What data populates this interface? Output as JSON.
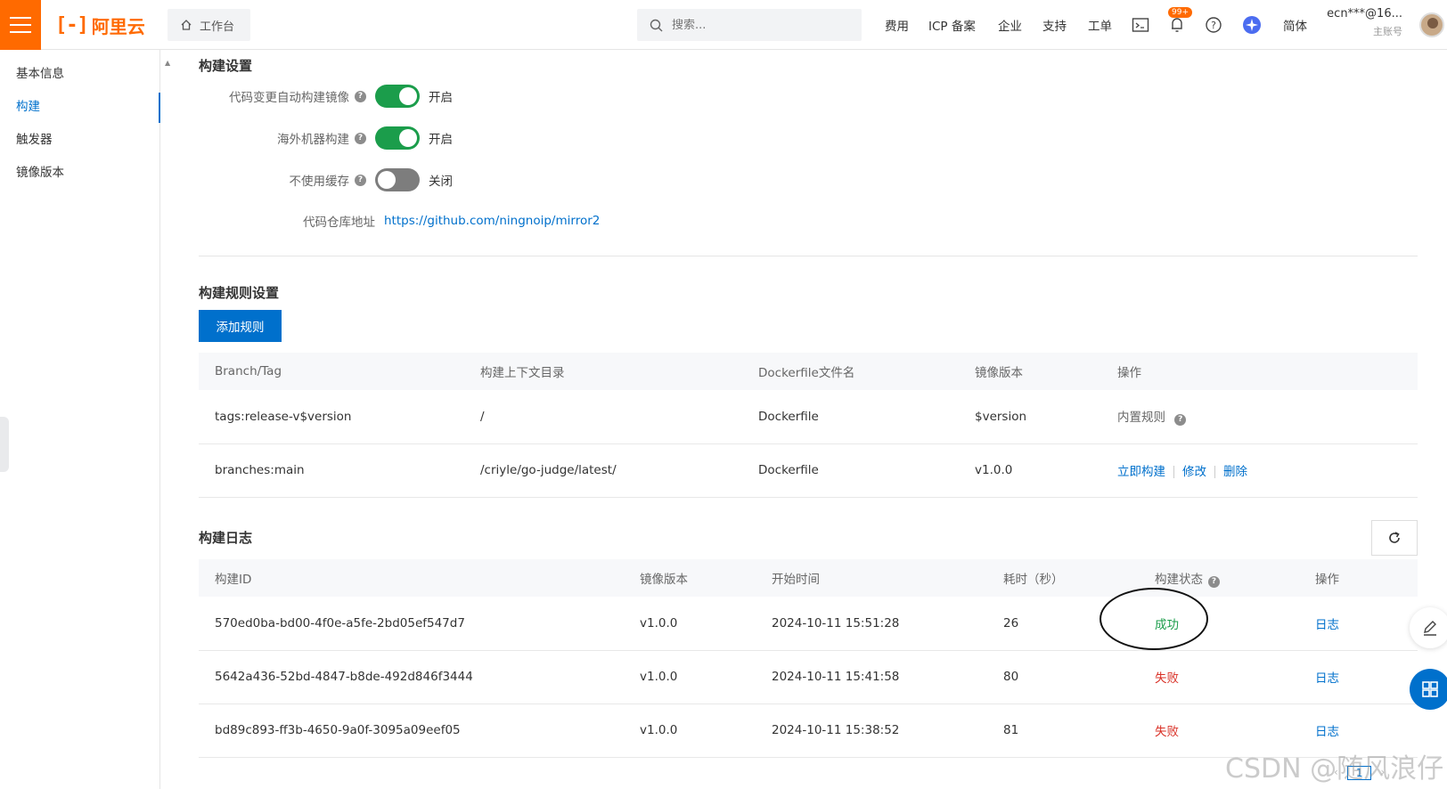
{
  "topbar": {
    "logo_text": "阿里云",
    "workbench_label": "工作台",
    "search_placeholder": "搜索...",
    "nav": [
      "费用",
      "ICP 备案",
      "企业",
      "支持",
      "工单"
    ],
    "notification_badge": "99+",
    "language_label": "简体",
    "account_name": "ecn***@16...",
    "account_role": "主账号"
  },
  "sidenav": {
    "items": [
      {
        "label": "基本信息",
        "active": false
      },
      {
        "label": "构建",
        "active": true
      },
      {
        "label": "触发器",
        "active": false
      },
      {
        "label": "镜像版本",
        "active": false
      }
    ]
  },
  "build_settings": {
    "title": "构建设置",
    "auto_build": {
      "label": "代码变更自动构建镜像",
      "state": "开启",
      "on": true
    },
    "overseas_build": {
      "label": "海外机器构建",
      "state": "开启",
      "on": true
    },
    "no_cache": {
      "label": "不使用缓存",
      "state": "关闭",
      "on": false
    },
    "repo": {
      "label": "代码仓库地址",
      "url": "https://github.com/ningnoip/mirror2"
    }
  },
  "build_rules": {
    "title": "构建规则设置",
    "add_button": "添加规则",
    "columns": [
      "Branch/Tag",
      "构建上下文目录",
      "Dockerfile文件名",
      "镜像版本",
      "操作"
    ],
    "rows": [
      {
        "branch_tag": "tags:release-v$version",
        "context": "/",
        "dockerfile": "Dockerfile",
        "version": "$version",
        "action": "内置规则"
      },
      {
        "branch_tag": "branches:main",
        "context": "/criyle/go-judge/latest/",
        "dockerfile": "Dockerfile",
        "version": "v1.0.0",
        "actions": [
          "立即构建",
          "修改",
          "删除"
        ]
      }
    ]
  },
  "build_logs": {
    "title": "构建日志",
    "columns": [
      "构建ID",
      "镜像版本",
      "开始时间",
      "耗时（秒）",
      "构建状态",
      "操作"
    ],
    "rows": [
      {
        "id": "570ed0ba-bd00-4f0e-a5fe-2bd05ef547d7",
        "version": "v1.0.0",
        "start": "2024-10-11 15:51:28",
        "duration": "26",
        "status": "成功",
        "action": "日志"
      },
      {
        "id": "5642a436-52bd-4847-b8de-492d846f3444",
        "version": "v1.0.0",
        "start": "2024-10-11 15:41:58",
        "duration": "80",
        "status": "失败",
        "action": "日志"
      },
      {
        "id": "bd89c893-ff3b-4650-9a0f-3095a09eef05",
        "version": "v1.0.0",
        "start": "2024-10-11 15:38:52",
        "duration": "81",
        "status": "失败",
        "action": "日志"
      }
    ]
  },
  "pager": {
    "current": "1"
  },
  "watermark": "CSDN @随风浪仔",
  "colors": {
    "brand": "#ff6a00",
    "primary": "#0070cc",
    "success": "#1b9d4b",
    "danger": "#d93026"
  }
}
